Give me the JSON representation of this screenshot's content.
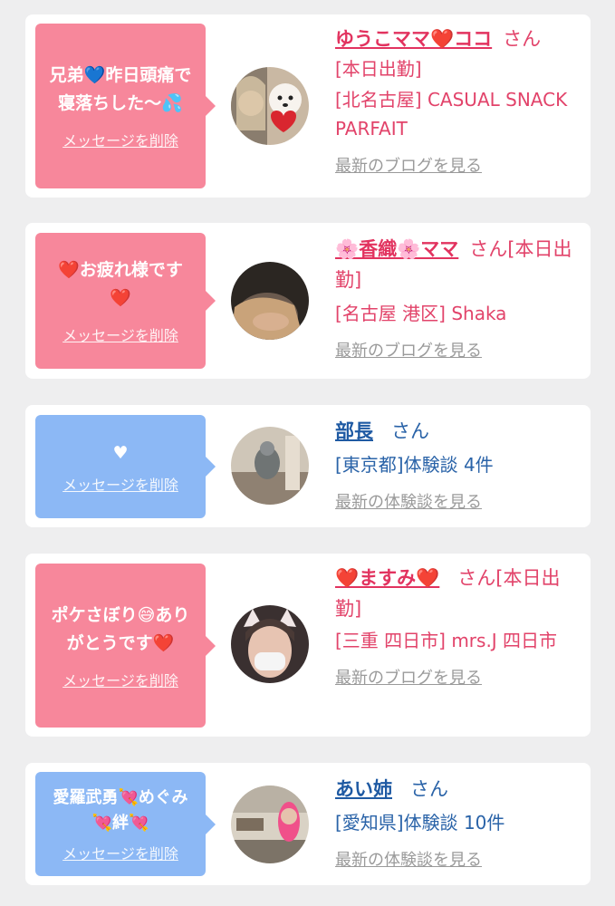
{
  "cards": [
    {
      "bubble_color": "#f7879b",
      "message": "兄弟💙昨日頭痛で寝落ちした〜💦",
      "delete_label": "メッセージを削除",
      "name": "ゆうこママ❤️ココ",
      "san_suffix": "さん",
      "lines": [
        "[本日出勤]",
        "[北名古屋] CASUAL SNACK PARFAIT"
      ],
      "link": "最新のブログを見る"
    },
    {
      "bubble_color": "#f7879b",
      "message": "❤️お疲れ様です❤️",
      "delete_label": "メッセージを削除",
      "name": "🌸香織🌸ママ",
      "san_suffix": "さん[本日出勤]",
      "lines": [
        "[名古屋 港区] Shaka"
      ],
      "link": "最新のブログを見る"
    },
    {
      "bubble_color": "#8cb8f5",
      "message": "♥",
      "delete_label": "メッセージを削除",
      "name": "部長",
      "san_suffix": "さん",
      "lines": [
        "[東京都]体験談 4件"
      ],
      "link": "最新の体験談を見る"
    },
    {
      "bubble_color": "#f7879b",
      "message": "ポケさぼり😅ありがとうです❤️",
      "delete_label": "メッセージを削除",
      "name": "❤️ますみ❤️",
      "san_suffix": "さん[本日出勤]",
      "lines": [
        "[三重 四日市] mrs.J 四日市"
      ],
      "link": "最新のブログを見る"
    },
    {
      "bubble_color": "#8cb8f5",
      "message": "愛羅武勇💘めぐみ💘絆💘",
      "delete_label": "メッセージを削除",
      "name": "あい姉",
      "san_suffix": "さん",
      "lines": [
        "[愛知県]体験談 10件"
      ],
      "link": "最新の体験談を見る"
    }
  ]
}
